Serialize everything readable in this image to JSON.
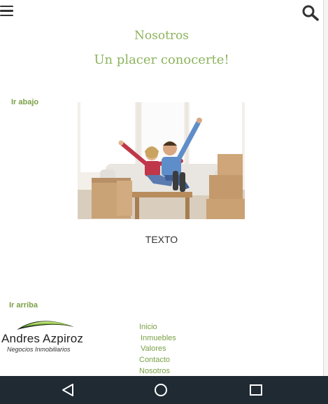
{
  "header": {
    "menu_icon": "hamburger-menu-icon",
    "search_icon": "search-icon"
  },
  "page": {
    "heading": "Nosotros",
    "subheading": "Un placer conocerte!",
    "ir_abajo": "Ir abajo",
    "photo": "couple-celebrating-on-sofa-with-moving-boxes",
    "body_text": "TEXTO",
    "ir_arriba": "Ir arriba"
  },
  "footer": {
    "logo": {
      "name": "Andres Azpiroz",
      "tagline": "Negocios Inmobiliarios"
    },
    "links": [
      "Inicio",
      "Inmuebles",
      "Valores",
      "Contacto",
      "Nosotros"
    ]
  },
  "android_nav": {
    "back": "back-triangle-icon",
    "home": "home-circle-icon",
    "recents": "recents-square-icon"
  },
  "colors": {
    "accent": "#8db35e",
    "link": "#7aa046",
    "nav_bar": "#1f2a33"
  }
}
